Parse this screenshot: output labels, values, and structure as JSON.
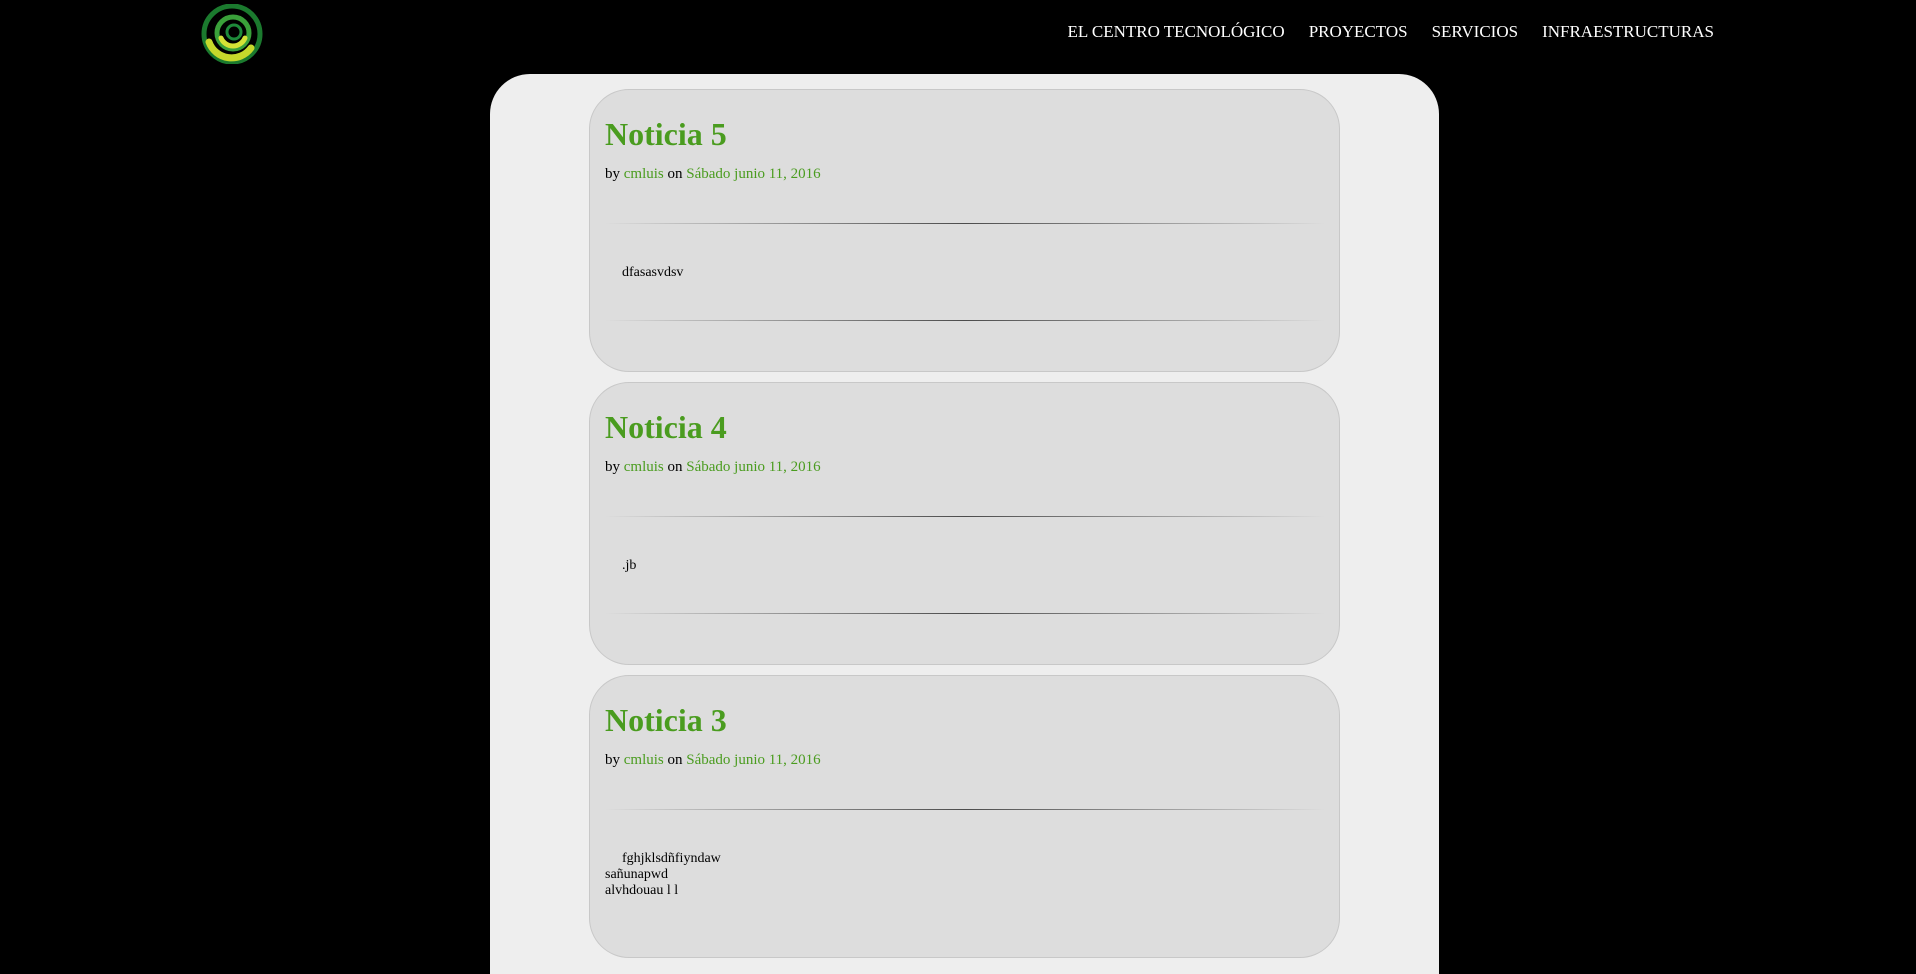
{
  "nav": {
    "items": [
      {
        "label": "EL CENTRO TECNOLÓGICO"
      },
      {
        "label": "PROYECTOS"
      },
      {
        "label": "SERVICIOS"
      },
      {
        "label": "INFRAESTRUCTURAS"
      }
    ]
  },
  "colors": {
    "background": "#000000",
    "panel": "#eeeeee",
    "card": "#dddddd",
    "accent": "#4a9c1f"
  },
  "posts": [
    {
      "title": "Noticia 5",
      "by": "by",
      "author": "cmluis",
      "on": "on",
      "date": "Sábado junio 11, 2016",
      "body_lines": [
        "dfasasvdsv"
      ]
    },
    {
      "title": "Noticia 4",
      "by": "by",
      "author": "cmluis",
      "on": "on",
      "date": "Sábado junio 11, 2016",
      "body_lines": [
        ".jb"
      ]
    },
    {
      "title": "Noticia 3",
      "by": "by",
      "author": "cmluis",
      "on": "on",
      "date": "Sábado junio 11, 2016",
      "body_lines": [
        "fghjklsdñfiyndaw",
        "sañunapwd",
        "alvhdouau l l"
      ]
    }
  ]
}
